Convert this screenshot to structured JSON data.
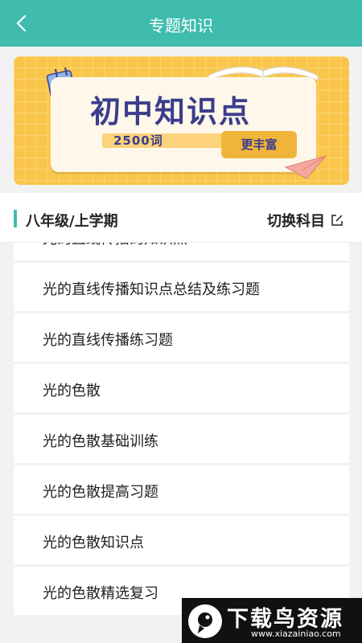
{
  "header": {
    "title": "专题知识",
    "back_icon": "chevron-left-icon",
    "background_color": "#3fbcae"
  },
  "banner": {
    "title": "初中知识点",
    "count": "2500词",
    "button_label": "更丰富",
    "background_color": "#f9c64b",
    "title_color": "#3b3d8c",
    "active_slide": 2,
    "slide_count": 2
  },
  "section": {
    "title": "八年级/上学期",
    "switch_label": "切换科目",
    "switch_icon": "edit-icon",
    "accent_color": "#3fbcae"
  },
  "list": {
    "items": [
      "光的直线传播的知识点",
      "光的直线传播知识点总结及练习题",
      "光的直线传播练习题",
      "光的色散",
      "光的色散基础训练",
      "光的色散提高习题",
      "光的色散知识点",
      "光的色散精选复习"
    ]
  },
  "watermark": {
    "brand": "下载鸟资源",
    "url": "www.xiazainiao.com"
  }
}
